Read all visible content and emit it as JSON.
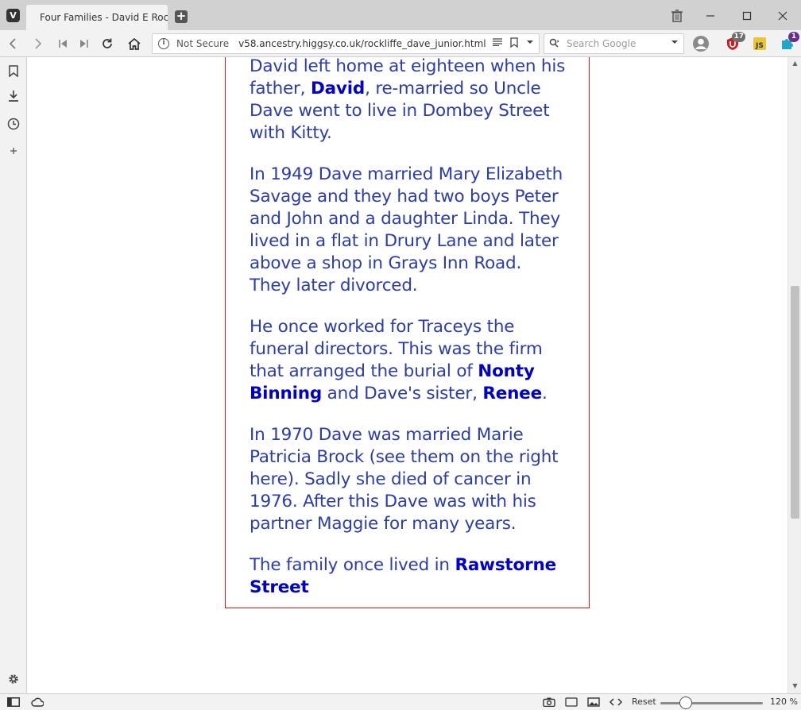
{
  "browser": {
    "tab_title": "Four Families - David E Rockliffe",
    "address": {
      "security": "Not Secure",
      "url": "v58.ancestry.higgsy.co.uk/rockliffe_dave_junior.html"
    },
    "search": {
      "placeholder": "Search Google"
    },
    "extensions": [
      {
        "name": "ublock",
        "badge": "17"
      },
      {
        "name": "js",
        "badge": ""
      },
      {
        "name": "puzzle",
        "badge": "1"
      }
    ]
  },
  "page": {
    "paragraphs": [
      {
        "parts": [
          {
            "text": "David left home at eighteen when his father, "
          },
          {
            "text": "David",
            "link": true
          },
          {
            "text": ", re-married so Uncle Dave went to live in Dombey Street with Kitty."
          }
        ]
      },
      {
        "parts": [
          {
            "text": "In 1949 Dave married Mary Elizabeth Savage and they had two boys Peter and John and a daughter Linda. They lived in a flat in Drury Lane and later above a shop in Grays Inn Road. They later divorced."
          }
        ]
      },
      {
        "parts": [
          {
            "text": "He once worked for Traceys the funeral directors. This was the firm that arranged the burial of "
          },
          {
            "text": "Nonty Binning",
            "link": true
          },
          {
            "text": " and Dave's sister, "
          },
          {
            "text": "Renee",
            "link": true
          },
          {
            "text": "."
          }
        ]
      },
      {
        "parts": [
          {
            "text": "In 1970 Dave was married Marie Patricia Brock (see them on the right here). Sadly she died of cancer in 1976.  After this Dave was with his partner Maggie for many years."
          }
        ]
      },
      {
        "parts": [
          {
            "text": "The family once lived in "
          },
          {
            "text": "Rawstorne Street",
            "link": true
          }
        ]
      }
    ]
  },
  "statusbar": {
    "reset_label": "Reset",
    "zoom": "120 %",
    "zoom_level": 0.25
  }
}
